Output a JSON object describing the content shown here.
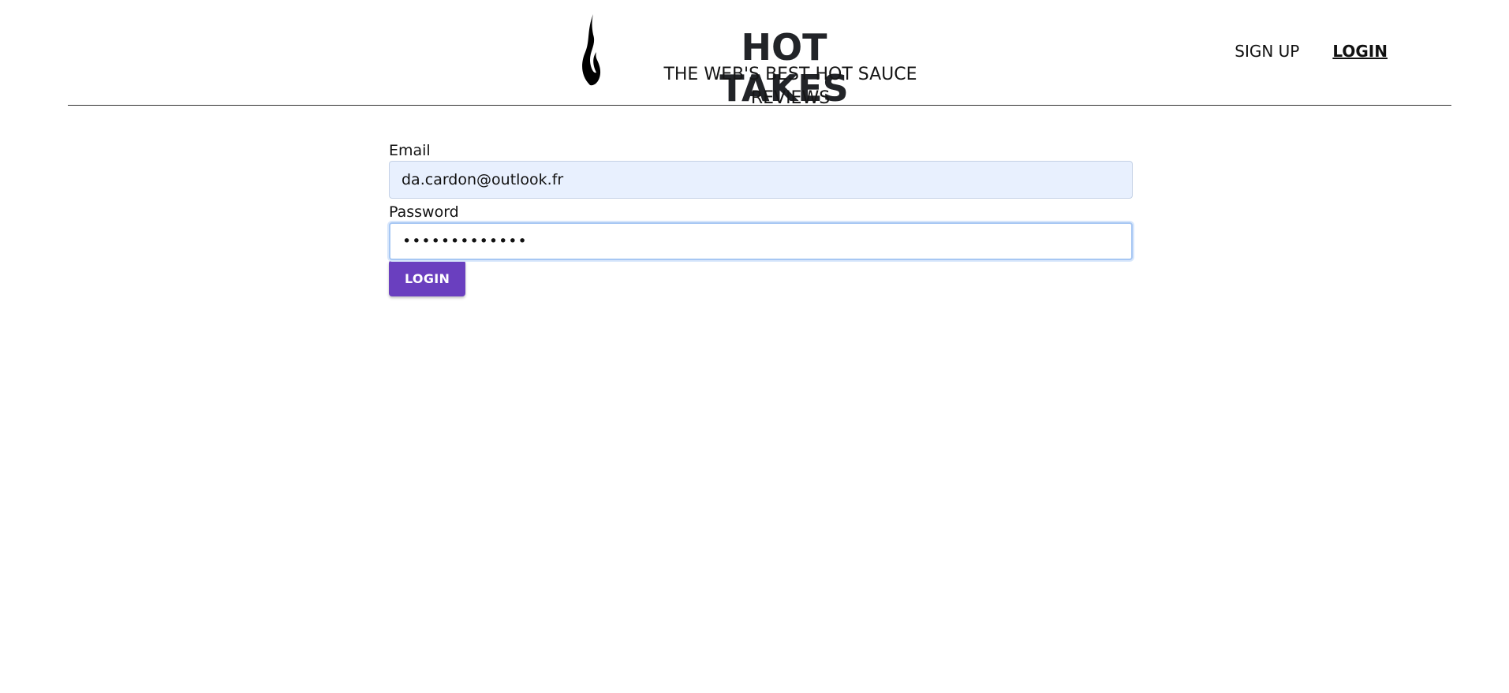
{
  "header": {
    "logo_icon": "flame-icon",
    "title": "HOT TAKES",
    "subtitle": "THE WEB'S BEST HOT SAUCE REVIEWS"
  },
  "nav": {
    "signup_label": "SIGN UP",
    "login_label": "LOGIN",
    "active": "login"
  },
  "form": {
    "email_label": "Email",
    "email_value": "da.cardon@outlook.fr",
    "password_label": "Password",
    "password_value": "•••••••••••••",
    "submit_label": "LOGIN"
  },
  "colors": {
    "button": "#6a3fbf",
    "autofill_background": "#e8f0fe",
    "focus_ring": "#a7c7f3"
  }
}
